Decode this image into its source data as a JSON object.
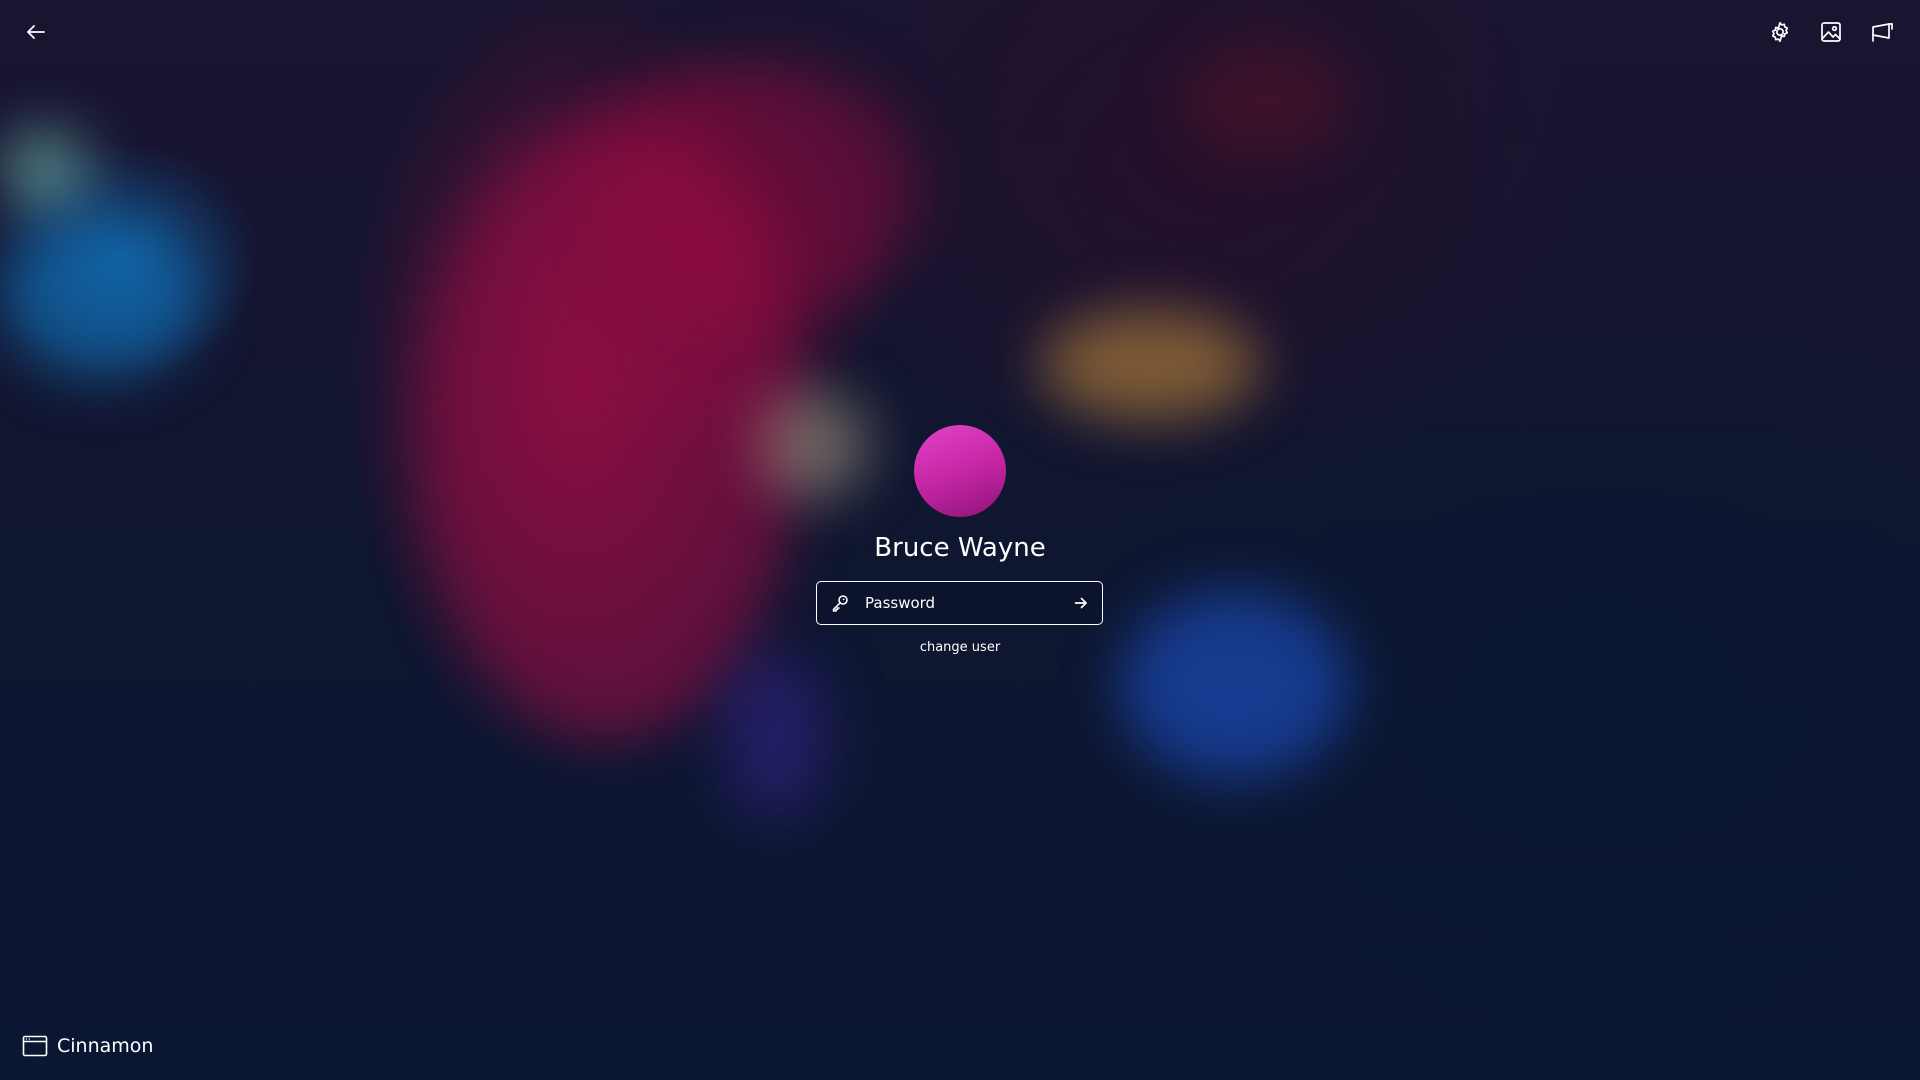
{
  "top_bar": {
    "back_icon": "arrow-left-icon",
    "settings_icon": "gear-icon",
    "wallpaper_icon": "image-icon",
    "screen_icon": "projector-screen-icon"
  },
  "login": {
    "avatar_color": "#d236b8",
    "user_name": "Bruce Wayne",
    "password_placeholder": "Password",
    "key_icon": "key-icon",
    "submit_icon": "arrow-right-icon",
    "change_user_label": "change user"
  },
  "session": {
    "icon": "window-icon",
    "label": "Cinnamon"
  }
}
